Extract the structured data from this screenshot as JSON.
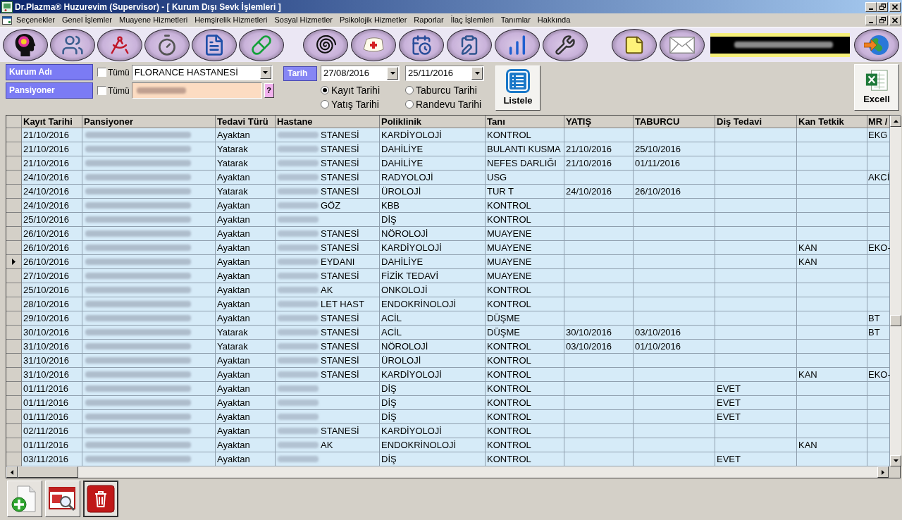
{
  "window": {
    "title": "Dr.Plazma® Huzurevim (Supervisor) - [ Kurum Dışı Sevk İşlemleri ]"
  },
  "menu": [
    "Seçenekler",
    "Genel İşlemler",
    "Muayene Hizmetleri",
    "Hemşirelik Hizmetleri",
    "Sosyal Hizmetler",
    "Psikolojik Hizmetler",
    "Raporlar",
    "İlaç İşlemleri",
    "Tanımlar",
    "Hakkında"
  ],
  "toolbar": {
    "groups": [
      {
        "buttons": [
          {
            "kind": "head"
          },
          {
            "kind": "doctors"
          },
          {
            "kind": "compass"
          },
          {
            "kind": "stopwatch"
          },
          {
            "kind": "document"
          },
          {
            "kind": "pills"
          }
        ]
      },
      {
        "buttons": [
          {
            "kind": "spiral"
          },
          {
            "kind": "nursecap"
          },
          {
            "kind": "notebook"
          },
          {
            "kind": "clipboard"
          },
          {
            "kind": "chart"
          },
          {
            "kind": "tools"
          }
        ]
      },
      {
        "buttons": [
          {
            "kind": "note"
          },
          {
            "kind": "mail"
          }
        ]
      }
    ],
    "exit_button": {
      "kind": "globe"
    }
  },
  "filters": {
    "institution": {
      "label": "Kurum Adı",
      "all": {
        "label": "Tümü",
        "checked": false
      },
      "value": "FLORANCE HASTANESİ"
    },
    "resident": {
      "label": "Pansiyoner",
      "all": {
        "label": "Tümü",
        "checked": false
      },
      "help_button": "?"
    },
    "date": {
      "label": "Tarih",
      "from": "27/08/2016",
      "to": "25/11/2016",
      "options": [
        {
          "label": "Kayıt Tarihi",
          "selected": true
        },
        {
          "label": "Taburcu Tarihi",
          "selected": false
        },
        {
          "label": "Yatış Tarihi",
          "selected": false
        },
        {
          "label": "Randevu Tarihi",
          "selected": false
        }
      ]
    },
    "list_button": "Listele",
    "excel_button": "Excell"
  },
  "table": {
    "columns": [
      "Kayıt Tarihi",
      "Pansiyoner",
      "Tedavi Türü",
      "Hastane",
      "Poliklinik",
      "Tanı",
      "YATIŞ",
      "TABURCU",
      "Diş Tedavi",
      "Kan Tetkik",
      "MR /"
    ],
    "rows": [
      {
        "kayit_tarihi": "21/10/2016",
        "tedavi_turu": "Ayaktan",
        "hastane": "STANESİ",
        "poliklinik": "KARDİYOLOJİ",
        "tani": "KONTROL",
        "mr": "EKG",
        "selected": false
      },
      {
        "kayit_tarihi": "21/10/2016",
        "tedavi_turu": "Yatarak",
        "hastane": "STANESİ",
        "poliklinik": "DAHİLİYE",
        "tani": "BULANTI KUSMA",
        "yatis": "21/10/2016",
        "taburcu": "25/10/2016",
        "selected": false
      },
      {
        "kayit_tarihi": "21/10/2016",
        "tedavi_turu": "Yatarak",
        "hastane": "STANESİ",
        "poliklinik": "DAHİLİYE",
        "tani": "NEFES DARLIĞI",
        "yatis": "21/10/2016",
        "taburcu": "01/11/2016",
        "selected": false
      },
      {
        "kayit_tarihi": "24/10/2016",
        "tedavi_turu": "Ayaktan",
        "hastane": "STANESİ",
        "poliklinik": "RADYOLOJİ",
        "tani": "USG",
        "mr": "AKCİ",
        "selected": false
      },
      {
        "kayit_tarihi": "24/10/2016",
        "tedavi_turu": "Yatarak",
        "hastane": "STANESİ",
        "poliklinik": "ÜROLOJİ",
        "tani": "TUR T",
        "yatis": "24/10/2016",
        "taburcu": "26/10/2016",
        "selected": false
      },
      {
        "kayit_tarihi": "24/10/2016",
        "tedavi_turu": "Ayaktan",
        "hastane": "GÖZ",
        "poliklinik": "KBB",
        "tani": "KONTROL",
        "selected": false
      },
      {
        "kayit_tarihi": "25/10/2016",
        "tedavi_turu": "Ayaktan",
        "poliklinik": "DİŞ",
        "tani": "KONTROL",
        "selected": false
      },
      {
        "kayit_tarihi": "26/10/2016",
        "tedavi_turu": "Ayaktan",
        "hastane": "STANESİ",
        "poliklinik": "NÖROLOJİ",
        "tani": "MUAYENE",
        "selected": false
      },
      {
        "kayit_tarihi": "26/10/2016",
        "tedavi_turu": "Ayaktan",
        "hastane": "STANESİ",
        "poliklinik": "KARDİYOLOJİ",
        "tani": "MUAYENE",
        "kan_tetkik": "KAN",
        "mr": "EKO-",
        "selected": false
      },
      {
        "kayit_tarihi": "26/10/2016",
        "tedavi_turu": "Ayaktan",
        "hastane": "EYDANI",
        "poliklinik": "DAHİLİYE",
        "tani": "MUAYENE",
        "kan_tetkik": "KAN",
        "selected": true
      },
      {
        "kayit_tarihi": "27/10/2016",
        "tedavi_turu": "Ayaktan",
        "hastane": "STANESİ",
        "poliklinik": "FİZİK TEDAVİ",
        "tani": "MUAYENE",
        "selected": false
      },
      {
        "kayit_tarihi": "25/10/2016",
        "tedavi_turu": "Ayaktan",
        "hastane": "AK",
        "poliklinik": "ONKOLOJİ",
        "tani": "KONTROL",
        "selected": false
      },
      {
        "kayit_tarihi": "28/10/2016",
        "tedavi_turu": "Ayaktan",
        "hastane": "LET HAST",
        "poliklinik": "ENDOKRİNOLOJİ",
        "tani": "KONTROL",
        "selected": false
      },
      {
        "kayit_tarihi": "29/10/2016",
        "tedavi_turu": "Ayaktan",
        "hastane": "STANESİ",
        "poliklinik": "ACİL",
        "tani": "DÜŞME",
        "mr": "BT",
        "selected": false
      },
      {
        "kayit_tarihi": "30/10/2016",
        "tedavi_turu": "Yatarak",
        "hastane": "STANESİ",
        "poliklinik": "ACİL",
        "tani": "DÜŞME",
        "yatis": "30/10/2016",
        "taburcu": "03/10/2016",
        "mr": "BT",
        "selected": false
      },
      {
        "kayit_tarihi": "31/10/2016",
        "tedavi_turu": "Yatarak",
        "hastane": "STANESİ",
        "poliklinik": "NÖROLOJİ",
        "tani": "KONTROL",
        "yatis": "03/10/2016",
        "taburcu": "01/10/2016",
        "selected": false
      },
      {
        "kayit_tarihi": "31/10/2016",
        "tedavi_turu": "Ayaktan",
        "hastane": "STANESİ",
        "poliklinik": "ÜROLOJİ",
        "tani": "KONTROL",
        "selected": false
      },
      {
        "kayit_tarihi": "31/10/2016",
        "tedavi_turu": "Ayaktan",
        "hastane": "STANESİ",
        "poliklinik": "KARDİYOLOJİ",
        "tani": "KONTROL",
        "kan_tetkik": "KAN",
        "mr": "EKO-",
        "selected": false
      },
      {
        "kayit_tarihi": "01/11/2016",
        "tedavi_turu": "Ayaktan",
        "poliklinik": "DİŞ",
        "tani": "KONTROL",
        "dis_tedavi": "EVET",
        "selected": false
      },
      {
        "kayit_tarihi": "01/11/2016",
        "tedavi_turu": "Ayaktan",
        "poliklinik": "DİŞ",
        "tani": "KONTROL",
        "dis_tedavi": "EVET",
        "selected": false
      },
      {
        "kayit_tarihi": "01/11/2016",
        "tedavi_turu": "Ayaktan",
        "poliklinik": "DİŞ",
        "tani": "KONTROL",
        "dis_tedavi": "EVET",
        "selected": false
      },
      {
        "kayit_tarihi": "02/11/2016",
        "tedavi_turu": "Ayaktan",
        "hastane": "STANESİ",
        "poliklinik": "KARDİYOLOJİ",
        "tani": "KONTROL",
        "selected": false
      },
      {
        "kayit_tarihi": "01/11/2016",
        "tedavi_turu": "Ayaktan",
        "hastane": "AK",
        "poliklinik": "ENDOKRİNOLOJİ",
        "tani": "KONTROL",
        "kan_tetkik": "KAN",
        "selected": false
      },
      {
        "kayit_tarihi": "03/11/2016",
        "tedavi_turu": "Ayaktan",
        "poliklinik": "DİŞ",
        "tani": "KONTROL",
        "dis_tedavi": "EVET",
        "selected": false
      }
    ]
  },
  "actions": [
    {
      "kind": "add"
    },
    {
      "kind": "view"
    },
    {
      "kind": "delete"
    }
  ]
}
